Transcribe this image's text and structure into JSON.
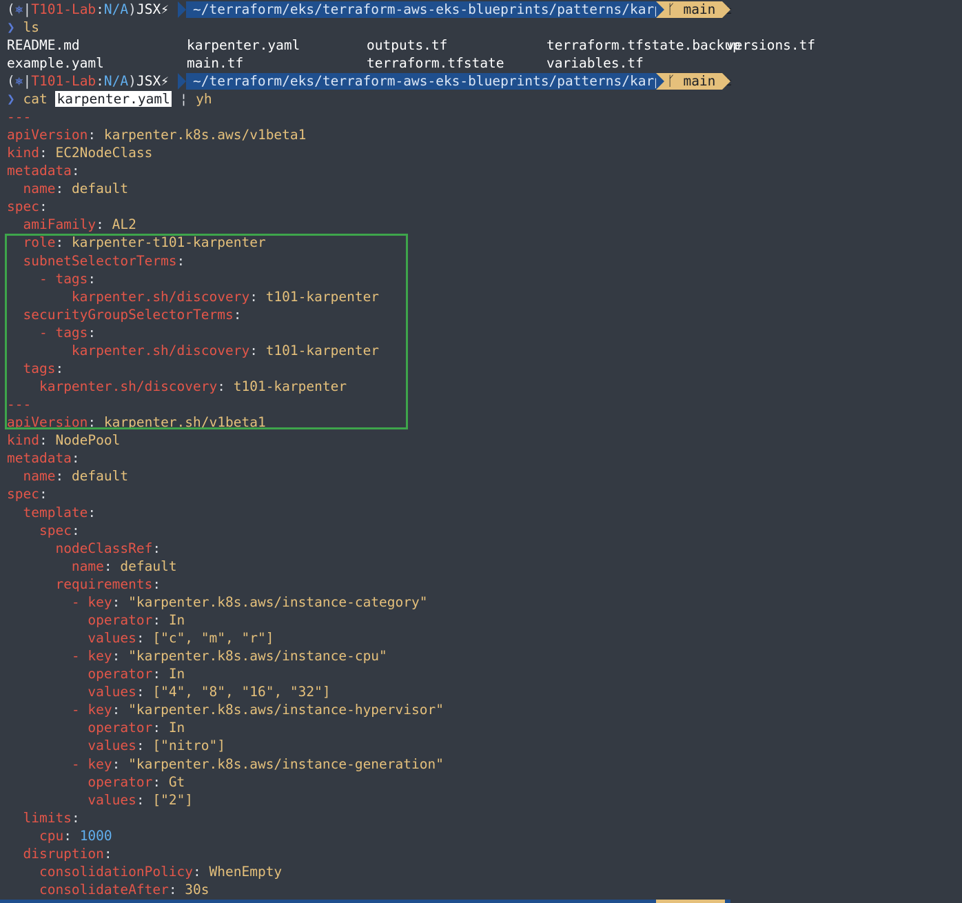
{
  "prompt": {
    "open_paren": "(",
    "kube_icon": "⎈",
    "separator": "|",
    "context": "T101-Lab",
    "colon": ":",
    "namespace": "N/A",
    "close_paren": ")",
    "user": "JSX⚡",
    "path": "~/terraform/eks/terraform-aws-eks-blueprints/patterns/karpenter",
    "git_icon": "ᚴ",
    "git_branch": "main ±"
  },
  "command1": "ls",
  "ls_files": [
    [
      "README.md",
      "karpenter.yaml",
      "outputs.tf",
      "terraform.tfstate.backup",
      "versions.tf"
    ],
    [
      "example.yaml",
      "main.tf",
      "terraform.tfstate",
      "variables.tf",
      ""
    ]
  ],
  "command2": {
    "cmd": "cat",
    "file": "karpenter.yaml",
    "pipe": "¦",
    "filter": "yh"
  },
  "yaml_lines": [
    {
      "indent": "",
      "key": "---",
      "sep": "",
      "val": ""
    },
    {
      "indent": "",
      "key": "apiVersion",
      "sep": ": ",
      "val": "karpenter.k8s.aws/v1beta1"
    },
    {
      "indent": "",
      "key": "kind",
      "sep": ": ",
      "val": "EC2NodeClass"
    },
    {
      "indent": "",
      "key": "metadata",
      "sep": ":",
      "val": ""
    },
    {
      "indent": "  ",
      "key": "name",
      "sep": ": ",
      "val": "default"
    },
    {
      "indent": "",
      "key": "spec",
      "sep": ":",
      "val": ""
    },
    {
      "indent": "  ",
      "key": "amiFamily",
      "sep": ": ",
      "val": "AL2"
    },
    {
      "indent": "  ",
      "key": "role",
      "sep": ": ",
      "val": "karpenter-t101-karpenter"
    },
    {
      "indent": "  ",
      "key": "subnetSelectorTerms",
      "sep": ":",
      "val": ""
    },
    {
      "indent": "    ",
      "key": "- tags",
      "sep": ":",
      "val": ""
    },
    {
      "indent": "        ",
      "key": "karpenter.sh/discovery",
      "sep": ": ",
      "val": "t101-karpenter"
    },
    {
      "indent": "  ",
      "key": "securityGroupSelectorTerms",
      "sep": ":",
      "val": ""
    },
    {
      "indent": "    ",
      "key": "- tags",
      "sep": ":",
      "val": ""
    },
    {
      "indent": "        ",
      "key": "karpenter.sh/discovery",
      "sep": ": ",
      "val": "t101-karpenter"
    },
    {
      "indent": "  ",
      "key": "tags",
      "sep": ":",
      "val": ""
    },
    {
      "indent": "    ",
      "key": "karpenter.sh/discovery",
      "sep": ": ",
      "val": "t101-karpenter"
    },
    {
      "indent": "",
      "key": "---",
      "sep": "",
      "val": ""
    },
    {
      "indent": "",
      "key": "apiVersion",
      "sep": ": ",
      "val": "karpenter.sh/v1beta1"
    },
    {
      "indent": "",
      "key": "kind",
      "sep": ": ",
      "val": "NodePool"
    },
    {
      "indent": "",
      "key": "metadata",
      "sep": ":",
      "val": ""
    },
    {
      "indent": "  ",
      "key": "name",
      "sep": ": ",
      "val": "default"
    },
    {
      "indent": "",
      "key": "spec",
      "sep": ":",
      "val": ""
    },
    {
      "indent": "  ",
      "key": "template",
      "sep": ":",
      "val": ""
    },
    {
      "indent": "    ",
      "key": "spec",
      "sep": ":",
      "val": ""
    },
    {
      "indent": "      ",
      "key": "nodeClassRef",
      "sep": ":",
      "val": ""
    },
    {
      "indent": "        ",
      "key": "name",
      "sep": ": ",
      "val": "default"
    },
    {
      "indent": "      ",
      "key": "requirements",
      "sep": ":",
      "val": ""
    },
    {
      "indent": "        ",
      "key": "- key",
      "sep": ": ",
      "val": "\"karpenter.k8s.aws/instance-category\""
    },
    {
      "indent": "          ",
      "key": "operator",
      "sep": ": ",
      "val": "In"
    },
    {
      "indent": "          ",
      "key": "values",
      "sep": ": ",
      "val": "[\"c\", \"m\", \"r\"]"
    },
    {
      "indent": "        ",
      "key": "- key",
      "sep": ": ",
      "val": "\"karpenter.k8s.aws/instance-cpu\""
    },
    {
      "indent": "          ",
      "key": "operator",
      "sep": ": ",
      "val": "In"
    },
    {
      "indent": "          ",
      "key": "values",
      "sep": ": ",
      "val": "[\"4\", \"8\", \"16\", \"32\"]"
    },
    {
      "indent": "        ",
      "key": "- key",
      "sep": ": ",
      "val": "\"karpenter.k8s.aws/instance-hypervisor\""
    },
    {
      "indent": "          ",
      "key": "operator",
      "sep": ": ",
      "val": "In"
    },
    {
      "indent": "          ",
      "key": "values",
      "sep": ": ",
      "val": "[\"nitro\"]"
    },
    {
      "indent": "        ",
      "key": "- key",
      "sep": ": ",
      "val": "\"karpenter.k8s.aws/instance-generation\""
    },
    {
      "indent": "          ",
      "key": "operator",
      "sep": ": ",
      "val": "Gt"
    },
    {
      "indent": "          ",
      "key": "values",
      "sep": ": ",
      "val": "[\"2\"]"
    },
    {
      "indent": "  ",
      "key": "limits",
      "sep": ":",
      "val": ""
    },
    {
      "indent": "    ",
      "key": "cpu",
      "sep": ": ",
      "val": "1000",
      "num": true
    },
    {
      "indent": "  ",
      "key": "disruption",
      "sep": ":",
      "val": ""
    },
    {
      "indent": "    ",
      "key": "consolidationPolicy",
      "sep": ": ",
      "val": "WhenEmpty"
    },
    {
      "indent": "    ",
      "key": "consolidateAfter",
      "sep": ": ",
      "val": "30s"
    }
  ],
  "colors": {
    "background": "#343a43",
    "yaml_key": "#e45649",
    "yaml_value": "#e5c07b",
    "number": "#61afef",
    "highlight_box": "#3ea54b",
    "path_segment": "#1f4f8e",
    "git_segment": "#e5c07b"
  }
}
